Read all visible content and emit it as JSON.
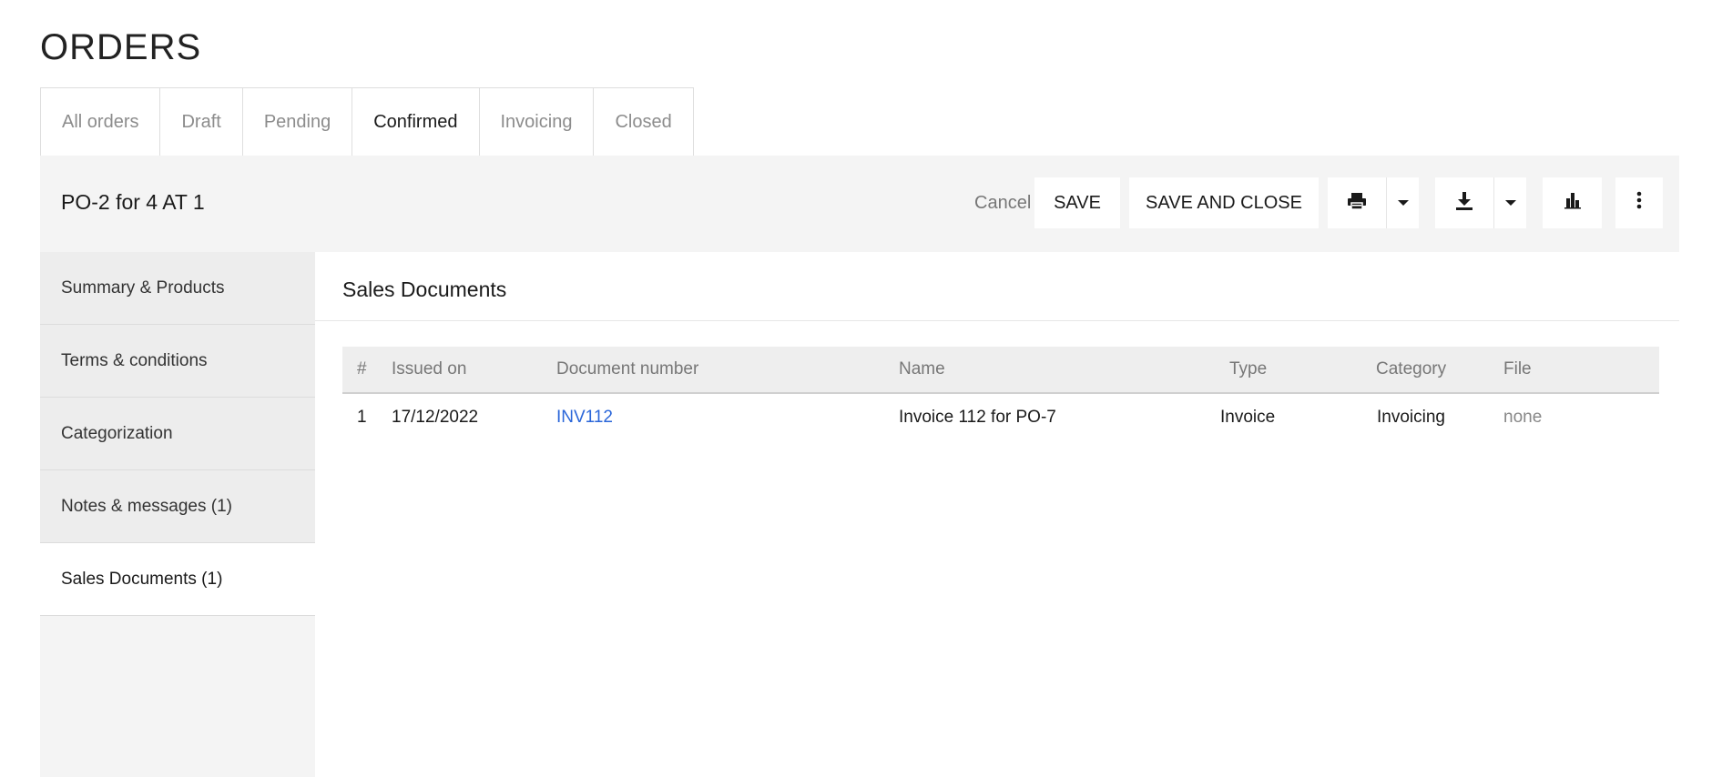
{
  "page": {
    "title": "ORDERS"
  },
  "tabs": [
    {
      "label": "All orders",
      "active": false
    },
    {
      "label": "Draft",
      "active": false
    },
    {
      "label": "Pending",
      "active": false
    },
    {
      "label": "Confirmed",
      "active": true
    },
    {
      "label": "Invoicing",
      "active": false
    },
    {
      "label": "Closed",
      "active": false
    }
  ],
  "toolbar": {
    "record_title": "PO-2 for 4 AT 1",
    "cancel_label": "Cancel",
    "save_label": "SAVE",
    "save_close_label": "SAVE AND CLOSE",
    "icons": {
      "print": "printer-icon",
      "download": "download-icon",
      "chart": "bar-chart-icon",
      "more": "kebab-menu-icon",
      "dropdown": "caret-down-icon"
    }
  },
  "sidebar": {
    "items": [
      {
        "label": "Summary & Products",
        "active": false
      },
      {
        "label": "Terms & conditions",
        "active": false
      },
      {
        "label": "Categorization",
        "active": false
      },
      {
        "label": "Notes & messages (1)",
        "active": false
      },
      {
        "label": "Sales Documents (1)",
        "active": true
      }
    ]
  },
  "main": {
    "section_title": "Sales Documents",
    "table": {
      "columns": [
        "#",
        "Issued on",
        "Document number",
        "Name",
        "Type",
        "Category",
        "File"
      ],
      "rows": [
        [
          "1",
          "17/12/2022",
          "INV112",
          "Invoice 112 for PO-7",
          "Invoice",
          "Invoicing",
          "none"
        ]
      ]
    }
  },
  "colors": {
    "link": "#2a66d9",
    "panel_bg": "#f4f4f4",
    "muted_text": "#888888"
  }
}
